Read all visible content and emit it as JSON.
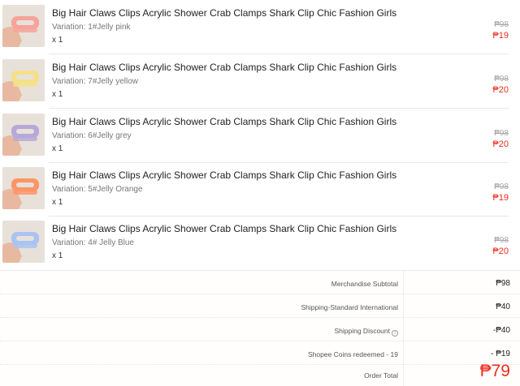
{
  "items": [
    {
      "title": "Big Hair Claws Clips Acrylic Shower Crab Clamps Shark Clip Chic Fashion Girls",
      "variation": "Variation: 1#Jelly pink",
      "qty": "x 1",
      "orig_price": "₱98",
      "price": "₱19",
      "color": "#f6a39a"
    },
    {
      "title": "Big Hair Claws Clips Acrylic Shower Crab Clamps Shark Clip Chic Fashion Girls",
      "variation": "Variation: 7#Jelly yellow",
      "qty": "x 1",
      "orig_price": "₱98",
      "price": "₱20",
      "color": "#f5e08a"
    },
    {
      "title": "Big Hair Claws Clips Acrylic Shower Crab Clamps Shark Clip Chic Fashion Girls",
      "variation": "Variation: 6#Jelly grey",
      "qty": "x 1",
      "orig_price": "₱98",
      "price": "₱20",
      "color": "#b6a9d8"
    },
    {
      "title": "Big Hair Claws Clips Acrylic Shower Crab Clamps Shark Clip Chic Fashion Girls",
      "variation": "Variation: 5#Jelly Orange",
      "qty": "x 1",
      "orig_price": "₱98",
      "price": "₱19",
      "color": "#ff9466"
    },
    {
      "title": "Big Hair Claws Clips Acrylic Shower Crab Clamps Shark Clip Chic Fashion Girls",
      "variation": "Variation: 4# Jelly Blue",
      "qty": "x 1",
      "orig_price": "₱98",
      "price": "₱20",
      "color": "#a9c3f2"
    }
  ],
  "summary": {
    "merchandise_subtotal": {
      "label": "Merchandise Subtotal",
      "value": "₱98"
    },
    "shipping": {
      "label": "Shipping-Standard International",
      "value": "₱40"
    },
    "shipping_discount": {
      "label": "Shipping Discount",
      "value": "-₱40"
    },
    "coins": {
      "label": "Shopee Coins redeemed - 19",
      "value": "- ₱19"
    },
    "order_total": {
      "label": "Order Total",
      "value": "₱79"
    }
  },
  "icons": {
    "info": "info-icon"
  },
  "colors": {
    "accent": "#ee2c1b",
    "muted": "#a9a9a9"
  }
}
